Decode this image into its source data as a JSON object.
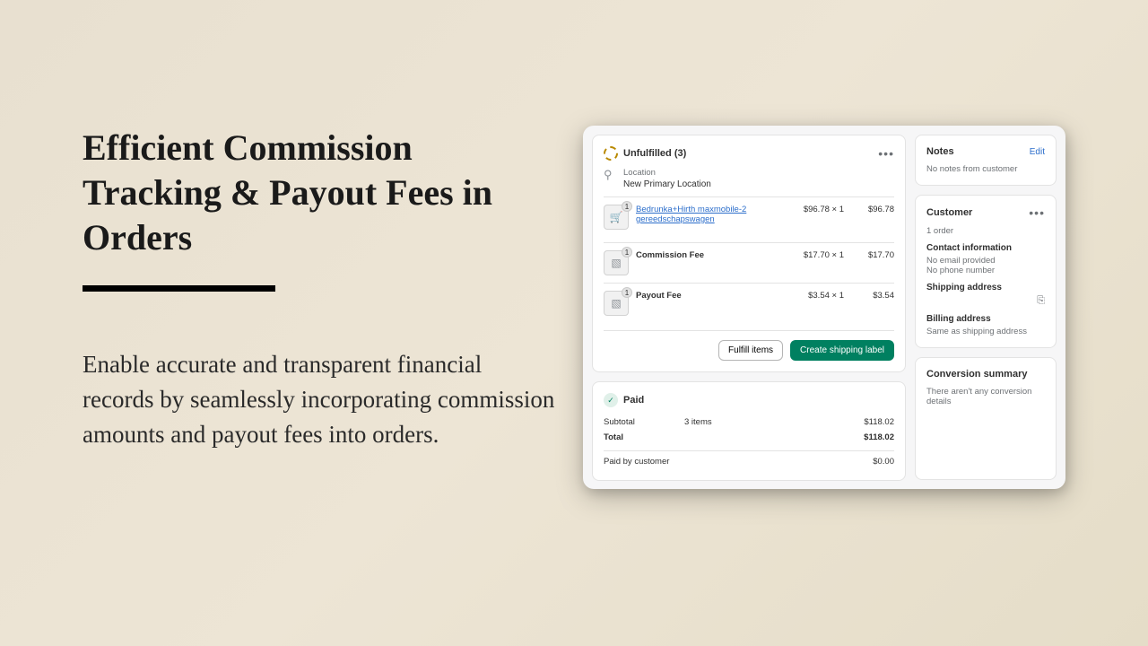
{
  "headline": "Efficient Commission Tracking & Payout Fees in Orders",
  "subtext": "Enable accurate and transparent financial records by seamlessly incorporating commission amounts and payout fees into orders.",
  "fulfillment": {
    "status": "Unfulfilled (3)",
    "location_label": "Location",
    "location_name": "New Primary Location",
    "items": [
      {
        "name": "Bedrunka+Hirth maxmobile-2 gereedschapswagen",
        "link": true,
        "sub": "",
        "qty": "$96.78 × 1",
        "price": "$96.78",
        "badge": "1",
        "icon": "🛒"
      },
      {
        "name": "Commission Fee",
        "link": false,
        "qty": "$17.70 × 1",
        "price": "$17.70",
        "badge": "1",
        "icon": "▧"
      },
      {
        "name": "Payout Fee",
        "link": false,
        "qty": "$3.54 × 1",
        "price": "$3.54",
        "badge": "1",
        "icon": "▧"
      }
    ],
    "fulfill_btn": "Fulfill items",
    "ship_btn": "Create shipping label"
  },
  "paid": {
    "title": "Paid",
    "subtotal_label": "Subtotal",
    "subtotal_mid": "3 items",
    "subtotal_val": "$118.02",
    "total_label": "Total",
    "total_val": "$118.02",
    "paid_label": "Paid by customer",
    "paid_val": "$0.00"
  },
  "notes": {
    "title": "Notes",
    "edit": "Edit",
    "body": "No notes from customer"
  },
  "customer": {
    "title": "Customer",
    "orders": "1 order",
    "contact_head": "Contact information",
    "no_email": "No email provided",
    "no_phone": "No phone number",
    "ship_head": "Shipping address",
    "bill_head": "Billing address",
    "bill_body": "Same as shipping address"
  },
  "conversion": {
    "title": "Conversion summary",
    "body": "There aren't any conversion details"
  }
}
